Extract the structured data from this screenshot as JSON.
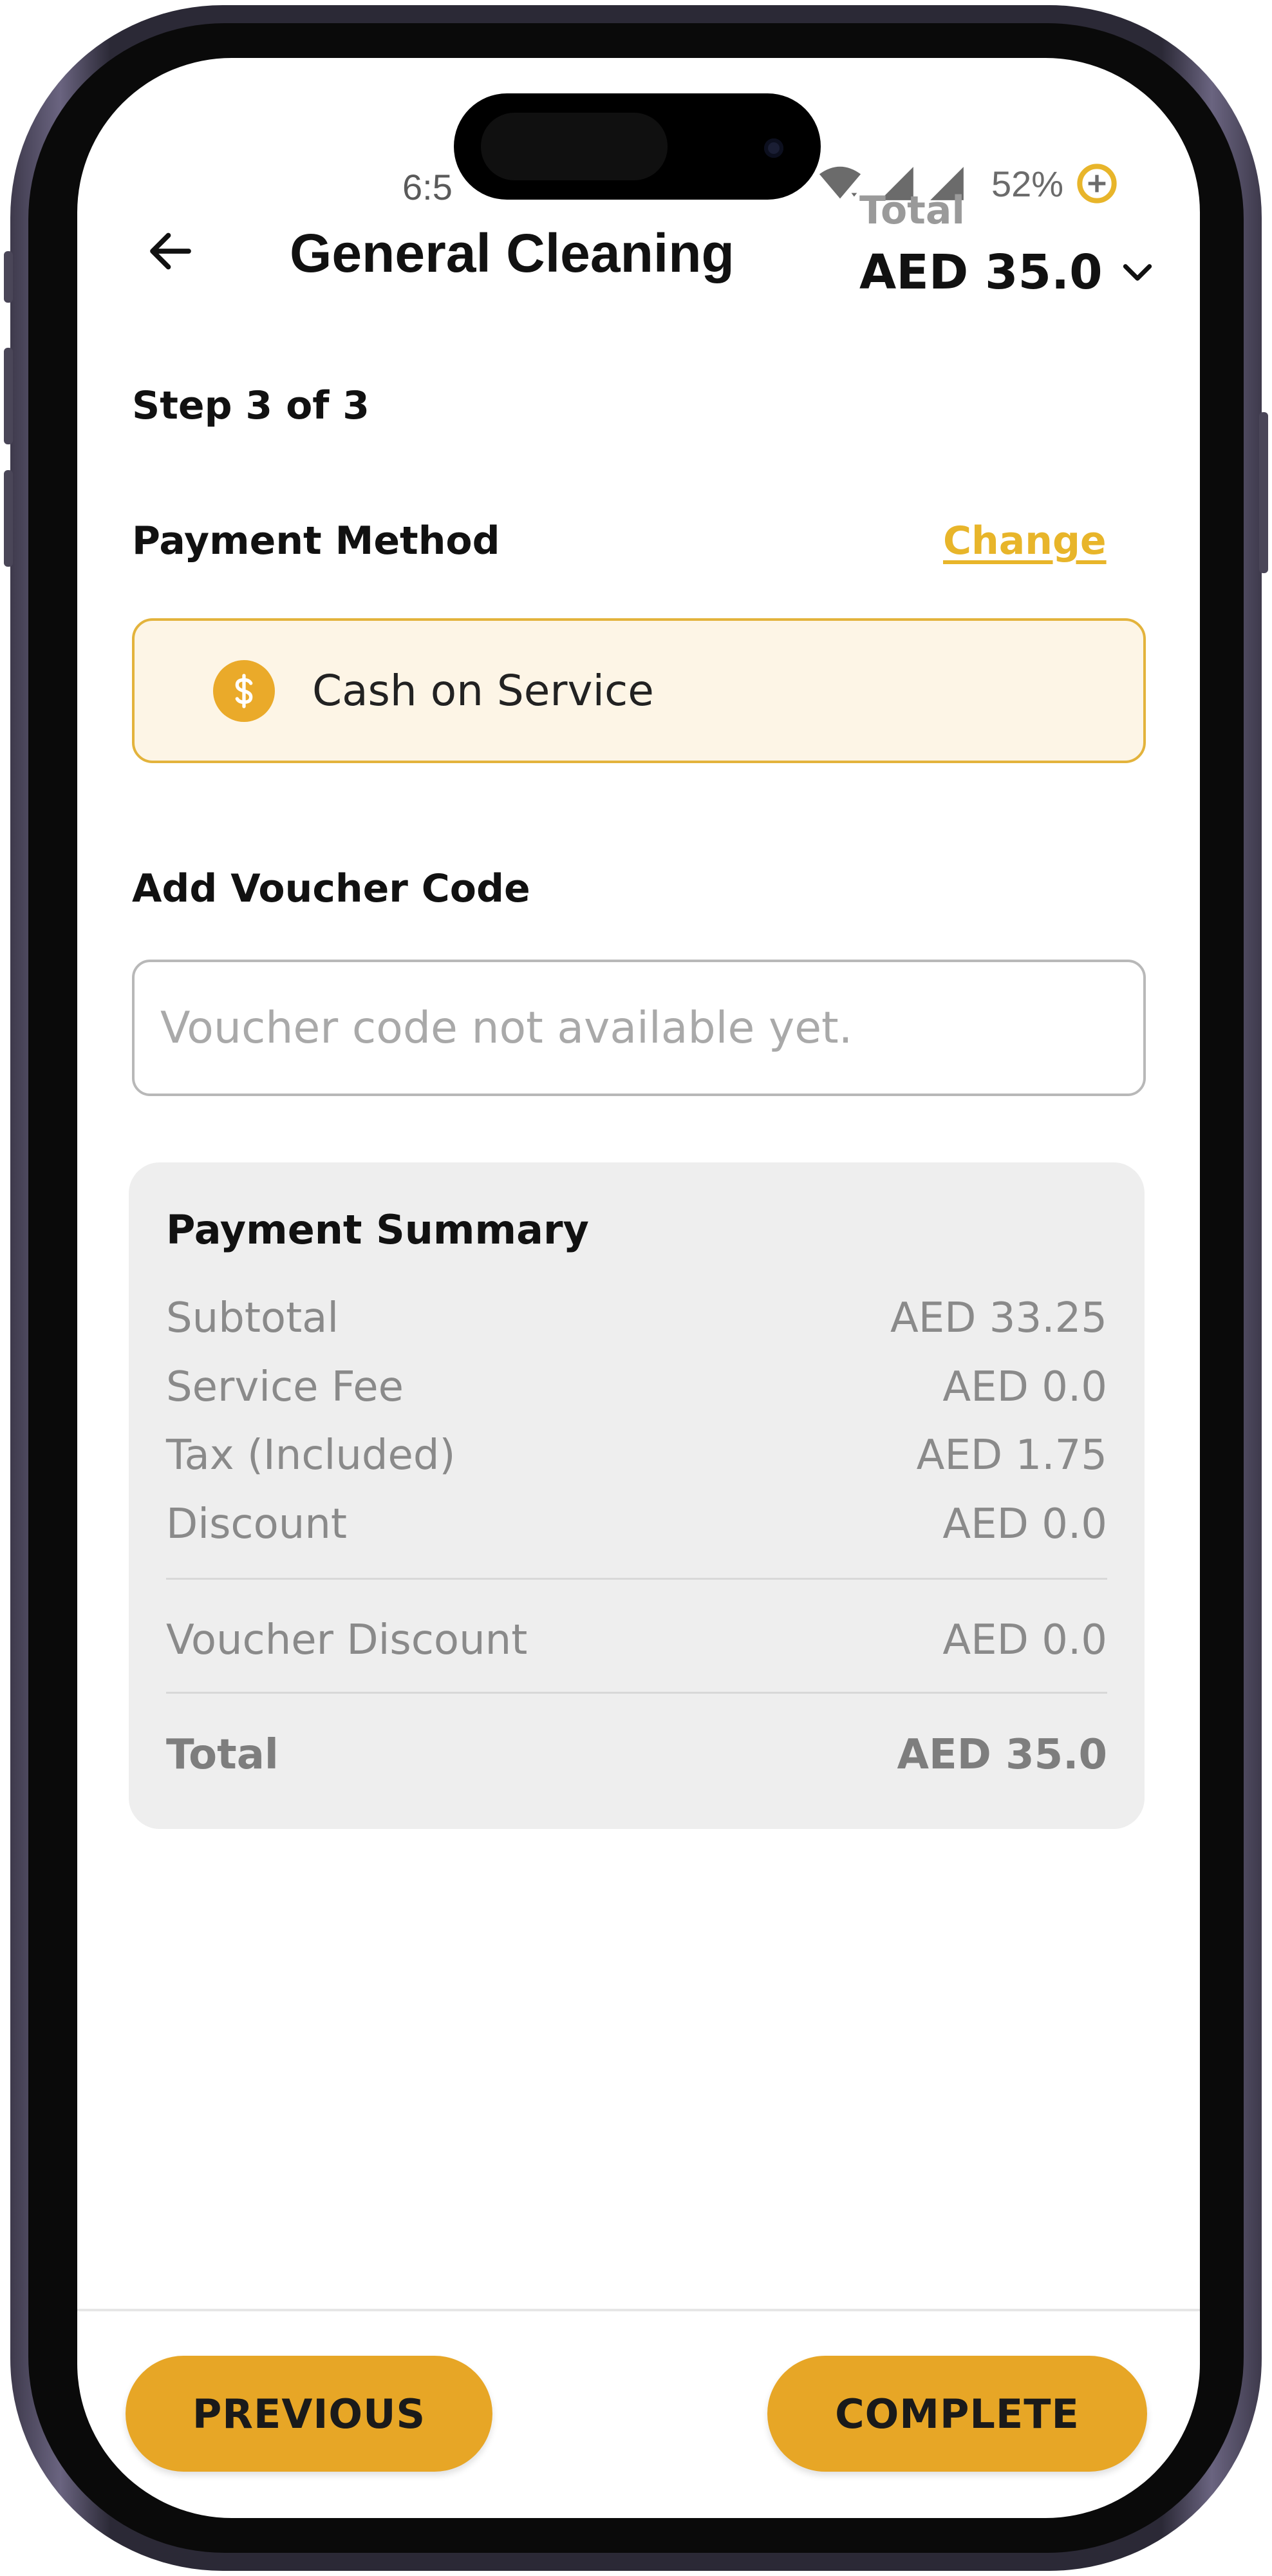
{
  "status_bar": {
    "time": "6:5",
    "battery": "52%"
  },
  "header": {
    "title": "General Cleaning",
    "total_label": "Total",
    "total_value": "AED 35.0"
  },
  "step": "Step 3 of 3",
  "payment_method": {
    "label": "Payment Method",
    "change_label": "Change",
    "selected": "Cash on Service"
  },
  "voucher": {
    "label": "Add Voucher Code",
    "placeholder": "Voucher code not available yet."
  },
  "summary": {
    "title": "Payment Summary",
    "rows": [
      {
        "label": "Subtotal",
        "value": "AED 33.25"
      },
      {
        "label": "Service Fee",
        "value": "AED 0.0"
      },
      {
        "label": "Tax (Included)",
        "value": "AED 1.75"
      },
      {
        "label": "Discount",
        "value": "AED 0.0"
      }
    ],
    "voucher_discount": {
      "label": "Voucher Discount",
      "value": "AED 0.0"
    },
    "total": {
      "label": "Total",
      "value": "AED 35.0"
    }
  },
  "buttons": {
    "previous": "PREVIOUS",
    "complete": "COMPLETE"
  },
  "colors": {
    "accent": "#e7a626",
    "card_border": "#e3b33c",
    "card_bg": "#fdf5e6",
    "summary_bg": "#eeeeee"
  }
}
